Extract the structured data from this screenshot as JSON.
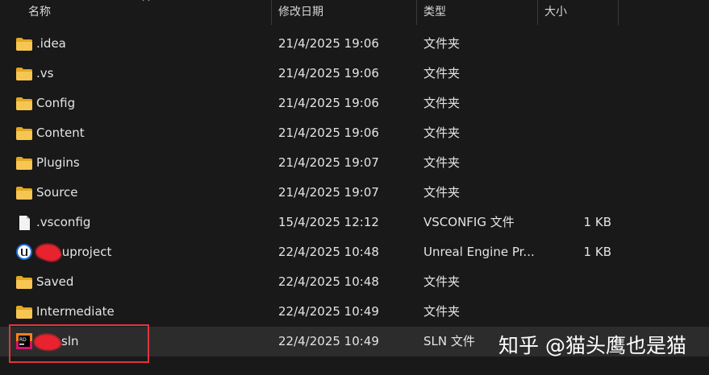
{
  "columns": {
    "name": "名称",
    "modified": "修改日期",
    "type": "类型",
    "size": "大小"
  },
  "files": [
    {
      "icon": "folder-icon",
      "name": ".idea",
      "modified": "21/4/2025 19:06",
      "type": "文件夹",
      "size": ""
    },
    {
      "icon": "folder-icon",
      "name": ".vs",
      "modified": "21/4/2025 19:06",
      "type": "文件夹",
      "size": ""
    },
    {
      "icon": "folder-icon",
      "name": "Config",
      "modified": "21/4/2025 19:06",
      "type": "文件夹",
      "size": ""
    },
    {
      "icon": "folder-icon",
      "name": "Content",
      "modified": "21/4/2025 19:06",
      "type": "文件夹",
      "size": ""
    },
    {
      "icon": "folder-icon",
      "name": "Plugins",
      "modified": "21/4/2025 19:07",
      "type": "文件夹",
      "size": ""
    },
    {
      "icon": "folder-icon",
      "name": "Source",
      "modified": "21/4/2025 19:07",
      "type": "文件夹",
      "size": ""
    },
    {
      "icon": "file-icon",
      "name": ".vsconfig",
      "modified": "15/4/2025 12:12",
      "type": "VSCONFIG 文件",
      "size": "1 KB"
    },
    {
      "icon": "unreal-engine-icon",
      "name": ".uproject",
      "modified": "22/4/2025 10:48",
      "type": "Unreal Engine Pr...",
      "size": "1 KB"
    },
    {
      "icon": "folder-icon",
      "name": "Saved",
      "modified": "22/4/2025 10:48",
      "type": "文件夹",
      "size": ""
    },
    {
      "icon": "folder-icon",
      "name": "Intermediate",
      "modified": "22/4/2025 10:49",
      "type": "文件夹",
      "size": ""
    },
    {
      "icon": "rider-icon",
      "name": "sln",
      "modified": "22/4/2025 10:49",
      "type": "SLN 文件",
      "size": "",
      "selected": true
    }
  ],
  "watermark": "知乎 @猫头鹰也是猫",
  "colors": {
    "folder": "#f4c04f",
    "highlight_box": "#e0353f",
    "redaction": "#e8232f"
  }
}
